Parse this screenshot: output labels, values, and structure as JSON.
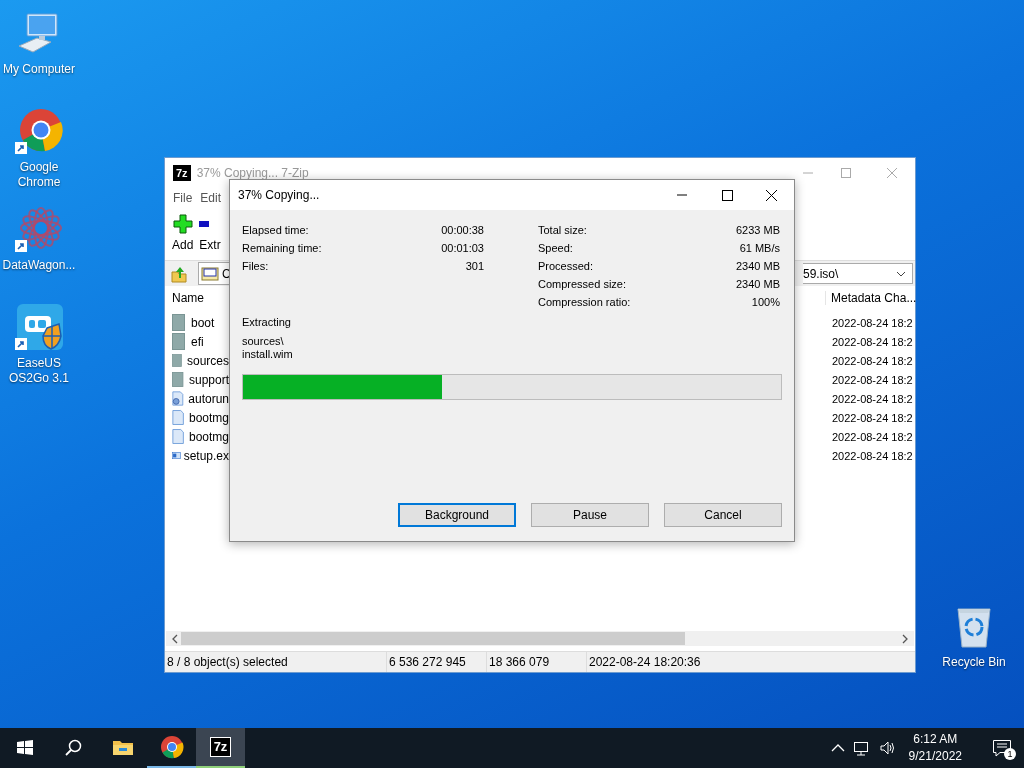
{
  "desktop_icons": [
    {
      "label": "My Computer",
      "kind": "computer",
      "shortcut": false
    },
    {
      "label": "Google Chrome",
      "kind": "chrome",
      "shortcut": true
    },
    {
      "label": "DataWagon...",
      "kind": "datawagon",
      "shortcut": true
    },
    {
      "label": "EaseUS OS2Go 3.1",
      "kind": "easeus",
      "shortcut": true
    }
  ],
  "recycle_bin": {
    "label": "Recycle Bin"
  },
  "main_window": {
    "logo": "7z",
    "title": "37% Copying... 7-Zip",
    "active": false,
    "menu": [
      "File",
      "Edit"
    ],
    "toolbar": [
      {
        "label": "Add",
        "kind": "add"
      },
      {
        "label": "Extr",
        "kind": "extract"
      }
    ],
    "address": {
      "start": "C",
      "end": "59.iso\\"
    },
    "columns": [
      "Name",
      "Metadata Cha..."
    ],
    "rows": [
      {
        "name": "boot",
        "kind": "folder",
        "metadata": "2022-08-24 18:2"
      },
      {
        "name": "efi",
        "kind": "folder",
        "metadata": "2022-08-24 18:2"
      },
      {
        "name": "sources",
        "kind": "folder",
        "metadata": "2022-08-24 18:2"
      },
      {
        "name": "support",
        "kind": "folder",
        "metadata": "2022-08-24 18:2"
      },
      {
        "name": "autorun",
        "kind": "settings",
        "metadata": "2022-08-24 18:2"
      },
      {
        "name": "bootmg",
        "kind": "file",
        "metadata": "2022-08-24 18:2"
      },
      {
        "name": "bootmg",
        "kind": "file",
        "metadata": "2022-08-24 18:2"
      },
      {
        "name": "setup.ex",
        "kind": "app",
        "metadata": "2022-08-24 18:2"
      }
    ],
    "status_bar": [
      "8 / 8 object(s) selected",
      "6 536 272 945",
      "18 366 079",
      "2022-08-24 18:20:36"
    ]
  },
  "dialog": {
    "title": "37% Copying...",
    "stats_left": [
      {
        "label": "Elapsed time:",
        "value": "00:00:38"
      },
      {
        "label": "Remaining time:",
        "value": "00:01:03"
      },
      {
        "label": "Files:",
        "value": "301"
      }
    ],
    "stats_right": [
      {
        "label": "Total size:",
        "value": "6233 MB"
      },
      {
        "label": "Speed:",
        "value": "61 MB/s"
      },
      {
        "label": "Processed:",
        "value": "2340 MB"
      },
      {
        "label": "Compressed size:",
        "value": "2340 MB"
      },
      {
        "label": "Compression ratio:",
        "value": "100%"
      }
    ],
    "operation": "Extracting",
    "path": "sources\\",
    "file": "install.wim",
    "progress": {
      "level": 0.37
    },
    "buttons": [
      {
        "label": "Background",
        "focused": true
      },
      {
        "label": "Pause",
        "focused": false
      },
      {
        "label": "Cancel",
        "focused": false
      }
    ]
  },
  "taskbar": {
    "apps": [
      {
        "kind": "start",
        "running": false,
        "active": false
      },
      {
        "kind": "search",
        "running": false,
        "active": false
      },
      {
        "kind": "explorer",
        "running": false,
        "active": false
      },
      {
        "kind": "chrome",
        "running": true,
        "active": false
      },
      {
        "kind": "sevenzip",
        "running": true,
        "active": true,
        "logo": "7z"
      }
    ],
    "time": "6:12 AM",
    "date": "9/21/2022",
    "notifications": "1"
  }
}
